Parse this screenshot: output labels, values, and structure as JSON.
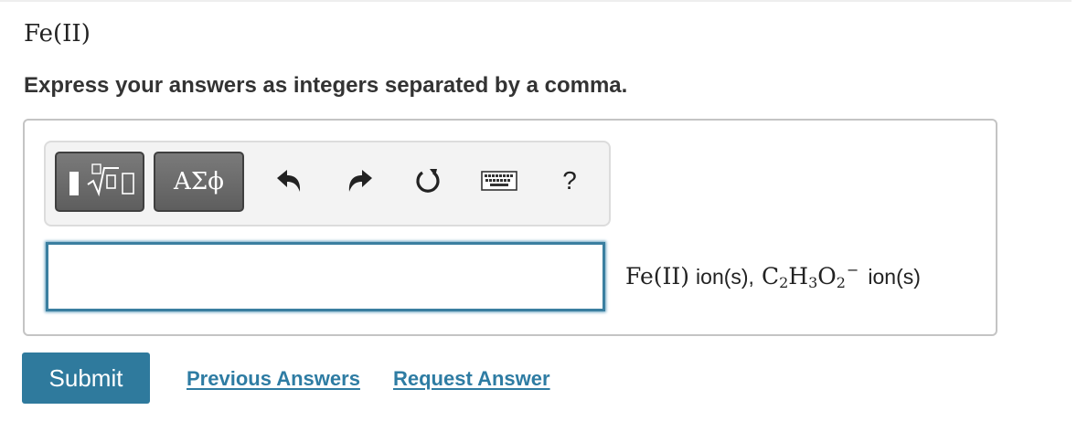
{
  "part": {
    "title": "Fe(II)",
    "instruction": "Express your answers as integers separated by a comma."
  },
  "toolbar": {
    "templates_icon": "templates-sqrt-icon",
    "greek_label": "ΑΣϕ",
    "undo_icon": "undo-icon",
    "redo_icon": "redo-icon",
    "reset_icon": "reset-icon",
    "keyboard_icon": "keyboard-icon",
    "help_label": "?"
  },
  "answer": {
    "value": ""
  },
  "units": {
    "ion1_name": "Fe(II)",
    "ion_suffix": "ion(s),",
    "ion2_c": "C",
    "ion2_c_sub": "2",
    "ion2_h": "H",
    "ion2_h_sub": "3",
    "ion2_o": "O",
    "ion2_o_sub": "2",
    "ion2_charge": "−",
    "ion2_suffix": "ion(s)"
  },
  "actions": {
    "submit_label": "Submit",
    "previous_answers_label": "Previous Answers",
    "request_answer_label": "Request Answer"
  },
  "colors": {
    "accent": "#2f7a9d",
    "link": "#2e7ca3",
    "toolbar_button": "#6b6b6b"
  }
}
